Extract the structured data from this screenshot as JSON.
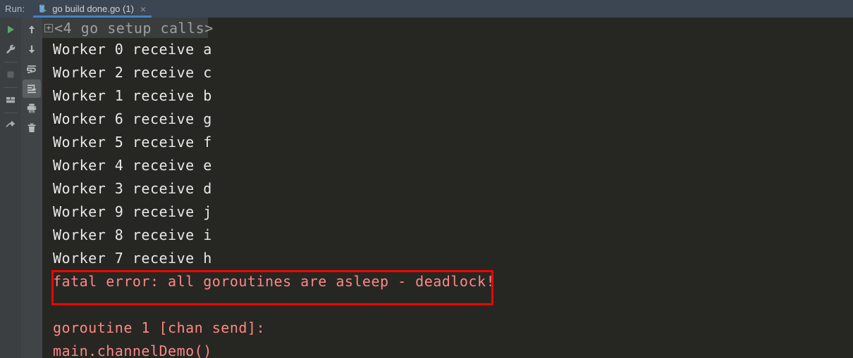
{
  "window": {
    "background_color": "#262723",
    "header_color": "#3c4552",
    "accent_color": "#4283c8"
  },
  "header": {
    "run_label": "Run:",
    "tab": {
      "title": "go build done.go (1)",
      "close_label": "×",
      "icon": "go-run-configuration-icon"
    }
  },
  "toolbar_left": {
    "items": [
      {
        "name": "rerun-button",
        "icon": "play-icon",
        "tooltip": "Rerun"
      },
      {
        "name": "settings-button",
        "icon": "wrench-icon",
        "tooltip": "Modify Run Configuration"
      },
      {
        "name": "stop-button",
        "icon": "stop-square-icon",
        "tooltip": "Stop",
        "enabled": false
      },
      {
        "name": "layout-button",
        "icon": "restore-layout-icon",
        "tooltip": "Layout Settings"
      },
      {
        "name": "pin-button",
        "icon": "pin-icon",
        "tooltip": "Pin Tab"
      }
    ]
  },
  "toolbar_right": {
    "items": [
      {
        "name": "prev-occurrence-button",
        "icon": "arrow-up-icon",
        "tooltip": "Up the Stack Trace"
      },
      {
        "name": "next-occurrence-button",
        "icon": "arrow-down-icon",
        "tooltip": "Down the Stack Trace"
      },
      {
        "name": "soft-wrap-button",
        "icon": "soft-wrap-icon",
        "tooltip": "Soft-Wrap"
      },
      {
        "name": "scroll-to-end-button",
        "icon": "scroll-to-end-icon",
        "tooltip": "Scroll to the end",
        "active": true
      },
      {
        "name": "print-button",
        "icon": "printer-icon",
        "tooltip": "Print"
      },
      {
        "name": "clear-all-button",
        "icon": "trash-icon",
        "tooltip": "Clear All"
      }
    ]
  },
  "console": {
    "fold": {
      "expander_label": "+",
      "text": "<4 go setup calls>",
      "text_color": "#9aa0a0",
      "highlight_color": "#3a3d3c"
    },
    "output_color": "#e8e8e8",
    "error_color": "#ff8785",
    "highlight_border_color": "#f40000",
    "lines": [
      {
        "text": "Worker 0 receive a",
        "kind": "out"
      },
      {
        "text": "Worker 2 receive c",
        "kind": "out"
      },
      {
        "text": "Worker 1 receive b",
        "kind": "out"
      },
      {
        "text": "Worker 6 receive g",
        "kind": "out"
      },
      {
        "text": "Worker 5 receive f",
        "kind": "out"
      },
      {
        "text": "Worker 4 receive e",
        "kind": "out"
      },
      {
        "text": "Worker 3 receive d",
        "kind": "out"
      },
      {
        "text": "Worker 9 receive j",
        "kind": "out"
      },
      {
        "text": "Worker 8 receive i",
        "kind": "out"
      },
      {
        "text": "Worker 7 receive h",
        "kind": "out"
      },
      {
        "text": "fatal error: all goroutines are asleep - deadlock!",
        "kind": "err"
      },
      {
        "text": "",
        "kind": "out"
      },
      {
        "text": "goroutine 1 [chan send]:",
        "kind": "err"
      },
      {
        "text": "main.channelDemo()",
        "kind": "err"
      }
    ]
  }
}
